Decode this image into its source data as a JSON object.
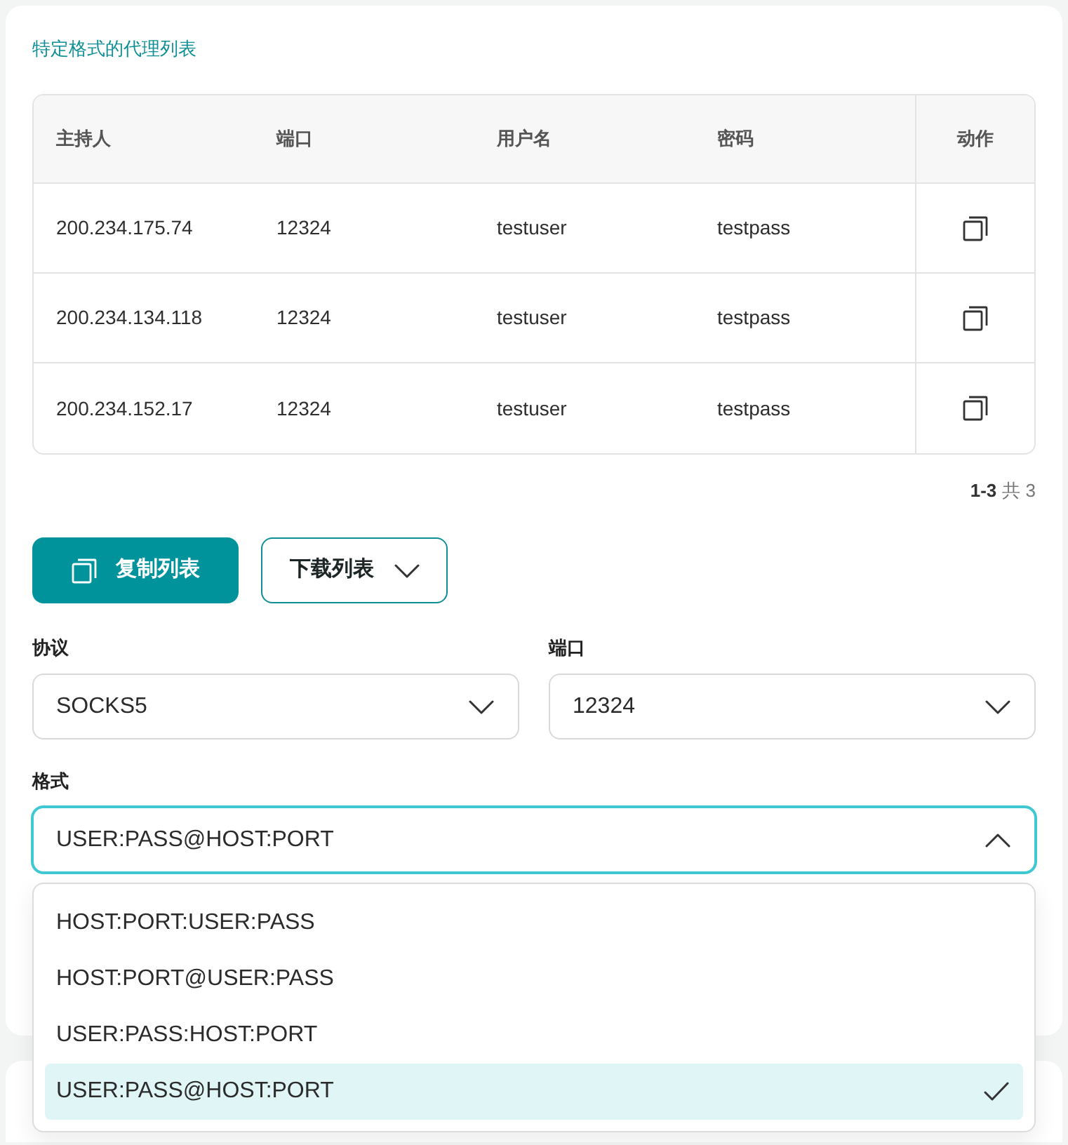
{
  "section_title": "特定格式的代理列表",
  "table": {
    "columns": [
      "主持人",
      "端口",
      "用户名",
      "密码",
      "动作"
    ],
    "rows": [
      {
        "host": "200.234.175.74",
        "port": "12324",
        "username": "testuser",
        "password": "testpass"
      },
      {
        "host": "200.234.134.118",
        "port": "12324",
        "username": "testuser",
        "password": "testpass"
      },
      {
        "host": "200.234.152.17",
        "port": "12324",
        "username": "testuser",
        "password": "testpass"
      }
    ]
  },
  "pagination": {
    "range": "1-3",
    "total": "共 3"
  },
  "buttons": [
    {
      "label": "复制列表",
      "kind": "primary"
    },
    {
      "label": "下载列表",
      "kind": "menu"
    }
  ],
  "fields": [
    {
      "label": "协议",
      "value": "SOCKS5",
      "expanded": false
    },
    {
      "label": "端口",
      "value": "12324",
      "expanded": false
    },
    {
      "label": "格式",
      "value": "USER:PASS@HOST:PORT",
      "expanded": true,
      "options": [
        {
          "label": "HOST:PORT:USER:PASS",
          "selected": false
        },
        {
          "label": "HOST:PORT@USER:PASS",
          "selected": false
        },
        {
          "label": "USER:PASS:HOST:PORT",
          "selected": false
        },
        {
          "label": "USER:PASS@HOST:PORT",
          "selected": true
        }
      ]
    }
  ]
}
